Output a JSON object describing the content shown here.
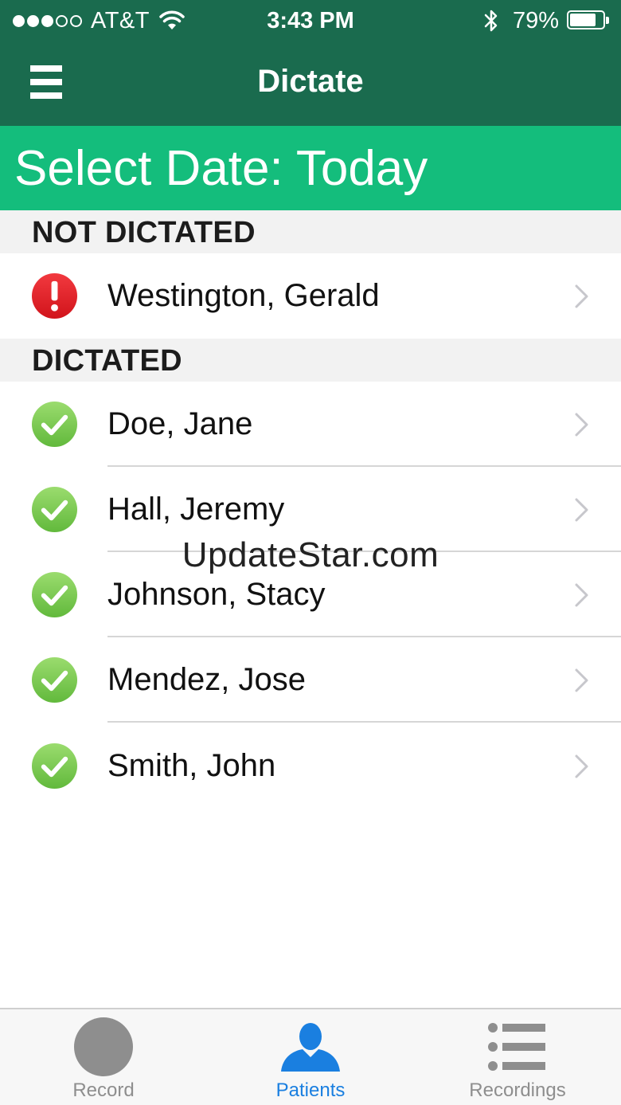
{
  "status_bar": {
    "carrier": "AT&T",
    "signal_filled": 3,
    "signal_total": 5,
    "time": "3:43 PM",
    "battery_percent": "79%",
    "battery_level": 0.79
  },
  "nav": {
    "title": "Dictate",
    "menu_icon": "hamburger-menu-icon"
  },
  "date_banner": {
    "label": "Select Date: Today"
  },
  "sections": [
    {
      "header": "NOT DICTATED",
      "status_icon": "alert-icon",
      "patients": [
        "Westington, Gerald"
      ]
    },
    {
      "header": "DICTATED",
      "status_icon": "checkmark-icon",
      "patients": [
        "Doe, Jane",
        "Hall, Jeremy",
        "Johnson, Stacy",
        "Mendez, Jose",
        "Smith, John"
      ]
    }
  ],
  "watermark": "UpdateStar.com",
  "tabs": [
    {
      "label": "Record",
      "icon": "record-icon",
      "active": false
    },
    {
      "label": "Patients",
      "icon": "person-icon",
      "active": true
    },
    {
      "label": "Recordings",
      "icon": "list-icon",
      "active": false
    }
  ],
  "colors": {
    "nav_bg": "#1a6b4e",
    "banner_bg": "#14bd7c",
    "alert_red": "#e8232a",
    "check_green": "#7ccd4e",
    "tab_active": "#1a7fe0",
    "tab_inactive": "#8e8e8e"
  }
}
